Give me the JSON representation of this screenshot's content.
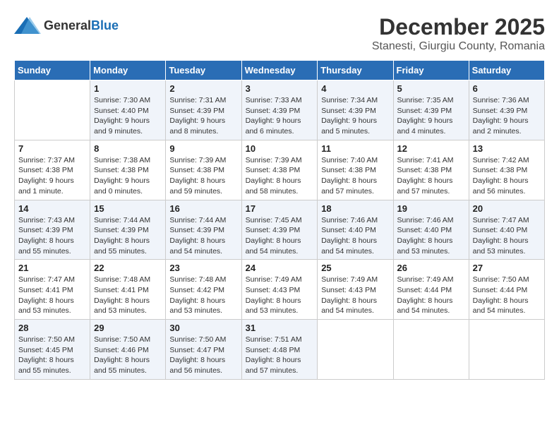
{
  "logo": {
    "general": "General",
    "blue": "Blue"
  },
  "title": {
    "month": "December 2025",
    "location": "Stanesti, Giurgiu County, Romania"
  },
  "days_header": [
    "Sunday",
    "Monday",
    "Tuesday",
    "Wednesday",
    "Thursday",
    "Friday",
    "Saturday"
  ],
  "weeks": [
    [
      {
        "day": "",
        "info": ""
      },
      {
        "day": "1",
        "info": "Sunrise: 7:30 AM\nSunset: 4:40 PM\nDaylight: 9 hours\nand 9 minutes."
      },
      {
        "day": "2",
        "info": "Sunrise: 7:31 AM\nSunset: 4:39 PM\nDaylight: 9 hours\nand 8 minutes."
      },
      {
        "day": "3",
        "info": "Sunrise: 7:33 AM\nSunset: 4:39 PM\nDaylight: 9 hours\nand 6 minutes."
      },
      {
        "day": "4",
        "info": "Sunrise: 7:34 AM\nSunset: 4:39 PM\nDaylight: 9 hours\nand 5 minutes."
      },
      {
        "day": "5",
        "info": "Sunrise: 7:35 AM\nSunset: 4:39 PM\nDaylight: 9 hours\nand 4 minutes."
      },
      {
        "day": "6",
        "info": "Sunrise: 7:36 AM\nSunset: 4:39 PM\nDaylight: 9 hours\nand 2 minutes."
      }
    ],
    [
      {
        "day": "7",
        "info": "Sunrise: 7:37 AM\nSunset: 4:38 PM\nDaylight: 9 hours\nand 1 minute."
      },
      {
        "day": "8",
        "info": "Sunrise: 7:38 AM\nSunset: 4:38 PM\nDaylight: 9 hours\nand 0 minutes."
      },
      {
        "day": "9",
        "info": "Sunrise: 7:39 AM\nSunset: 4:38 PM\nDaylight: 8 hours\nand 59 minutes."
      },
      {
        "day": "10",
        "info": "Sunrise: 7:39 AM\nSunset: 4:38 PM\nDaylight: 8 hours\nand 58 minutes."
      },
      {
        "day": "11",
        "info": "Sunrise: 7:40 AM\nSunset: 4:38 PM\nDaylight: 8 hours\nand 57 minutes."
      },
      {
        "day": "12",
        "info": "Sunrise: 7:41 AM\nSunset: 4:38 PM\nDaylight: 8 hours\nand 57 minutes."
      },
      {
        "day": "13",
        "info": "Sunrise: 7:42 AM\nSunset: 4:38 PM\nDaylight: 8 hours\nand 56 minutes."
      }
    ],
    [
      {
        "day": "14",
        "info": "Sunrise: 7:43 AM\nSunset: 4:39 PM\nDaylight: 8 hours\nand 55 minutes."
      },
      {
        "day": "15",
        "info": "Sunrise: 7:44 AM\nSunset: 4:39 PM\nDaylight: 8 hours\nand 55 minutes."
      },
      {
        "day": "16",
        "info": "Sunrise: 7:44 AM\nSunset: 4:39 PM\nDaylight: 8 hours\nand 54 minutes."
      },
      {
        "day": "17",
        "info": "Sunrise: 7:45 AM\nSunset: 4:39 PM\nDaylight: 8 hours\nand 54 minutes."
      },
      {
        "day": "18",
        "info": "Sunrise: 7:46 AM\nSunset: 4:40 PM\nDaylight: 8 hours\nand 54 minutes."
      },
      {
        "day": "19",
        "info": "Sunrise: 7:46 AM\nSunset: 4:40 PM\nDaylight: 8 hours\nand 53 minutes."
      },
      {
        "day": "20",
        "info": "Sunrise: 7:47 AM\nSunset: 4:40 PM\nDaylight: 8 hours\nand 53 minutes."
      }
    ],
    [
      {
        "day": "21",
        "info": "Sunrise: 7:47 AM\nSunset: 4:41 PM\nDaylight: 8 hours\nand 53 minutes."
      },
      {
        "day": "22",
        "info": "Sunrise: 7:48 AM\nSunset: 4:41 PM\nDaylight: 8 hours\nand 53 minutes."
      },
      {
        "day": "23",
        "info": "Sunrise: 7:48 AM\nSunset: 4:42 PM\nDaylight: 8 hours\nand 53 minutes."
      },
      {
        "day": "24",
        "info": "Sunrise: 7:49 AM\nSunset: 4:43 PM\nDaylight: 8 hours\nand 53 minutes."
      },
      {
        "day": "25",
        "info": "Sunrise: 7:49 AM\nSunset: 4:43 PM\nDaylight: 8 hours\nand 54 minutes."
      },
      {
        "day": "26",
        "info": "Sunrise: 7:49 AM\nSunset: 4:44 PM\nDaylight: 8 hours\nand 54 minutes."
      },
      {
        "day": "27",
        "info": "Sunrise: 7:50 AM\nSunset: 4:44 PM\nDaylight: 8 hours\nand 54 minutes."
      }
    ],
    [
      {
        "day": "28",
        "info": "Sunrise: 7:50 AM\nSunset: 4:45 PM\nDaylight: 8 hours\nand 55 minutes."
      },
      {
        "day": "29",
        "info": "Sunrise: 7:50 AM\nSunset: 4:46 PM\nDaylight: 8 hours\nand 55 minutes."
      },
      {
        "day": "30",
        "info": "Sunrise: 7:50 AM\nSunset: 4:47 PM\nDaylight: 8 hours\nand 56 minutes."
      },
      {
        "day": "31",
        "info": "Sunrise: 7:51 AM\nSunset: 4:48 PM\nDaylight: 8 hours\nand 57 minutes."
      },
      {
        "day": "",
        "info": ""
      },
      {
        "day": "",
        "info": ""
      },
      {
        "day": "",
        "info": ""
      }
    ]
  ]
}
